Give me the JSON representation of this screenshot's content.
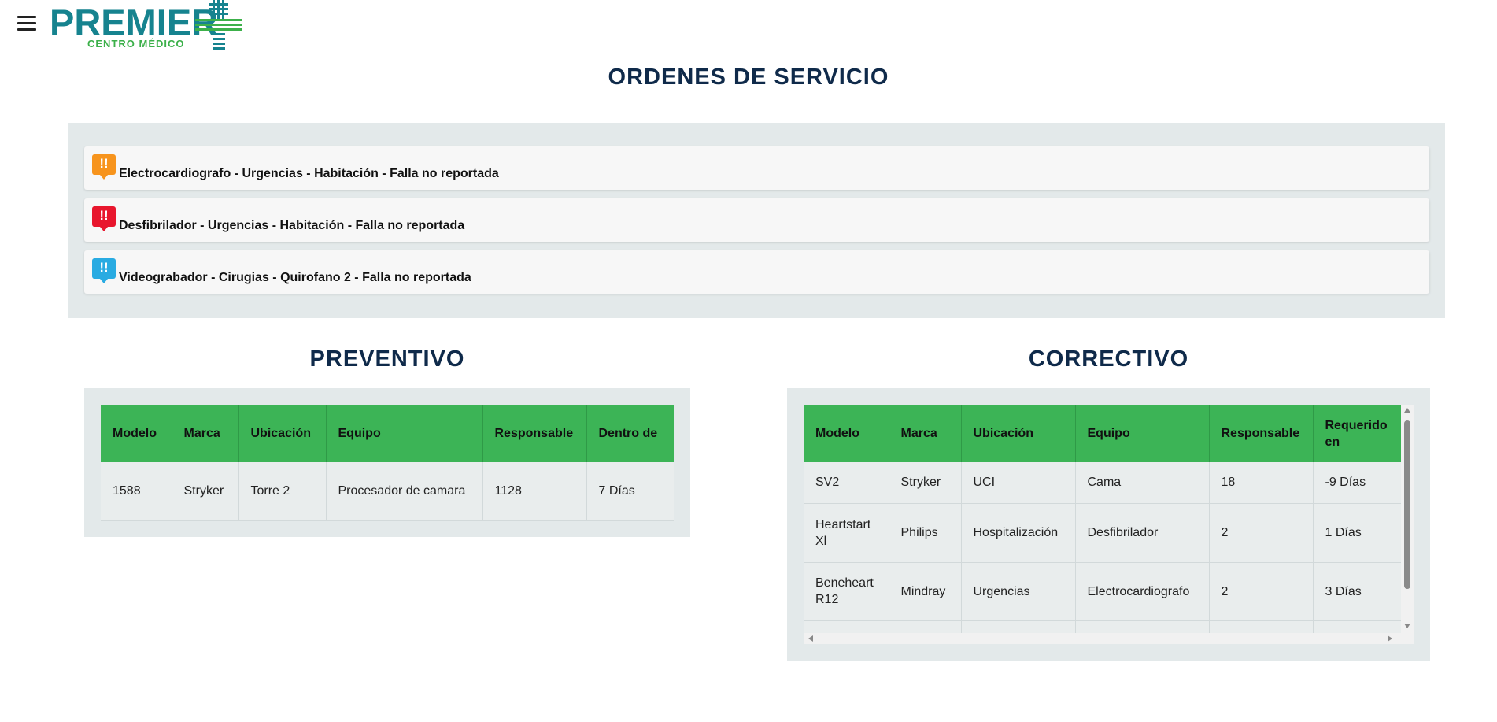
{
  "header": {
    "logo_text": "PREMIER",
    "logo_subtext": "CENTRO MÉDICO"
  },
  "page_title": "ORDENES DE SERVICIO",
  "alerts": [
    {
      "icon": "!!",
      "color": "#f7941d",
      "text": "Electrocardiografo - Urgencias - Habitación - Falla no reportada"
    },
    {
      "icon": "!!",
      "color": "#e8162d",
      "text": "Desfibrilador - Urgencias - Habitación - Falla no reportada"
    },
    {
      "icon": "!!",
      "color": "#29abe2",
      "text": "Videograbador - Cirugias - Quirofano 2 - Falla no reportada"
    }
  ],
  "preventivo": {
    "title": "PREVENTIVO",
    "headers": [
      "Modelo",
      "Marca",
      "Ubicación",
      "Equipo",
      "Responsable",
      "Dentro de"
    ],
    "rows": [
      [
        "1588",
        "Stryker",
        "Torre 2",
        "Procesador de camara",
        "1128",
        "7 Días"
      ]
    ]
  },
  "correctivo": {
    "title": "CORRECTIVO",
    "headers": [
      "Modelo",
      "Marca",
      "Ubicación",
      "Equipo",
      "Responsable",
      "Requerido en"
    ],
    "rows": [
      [
        "SV2",
        "Stryker",
        "UCI",
        "Cama",
        "18",
        "-9 Días"
      ],
      [
        "Heartstart Xl",
        "Philips",
        "Hospitalización",
        "Desfibrilador",
        "2",
        "1 Días"
      ],
      [
        "Beneheart R12",
        "Mindray",
        "Urgencias",
        "Electrocardiografo",
        "2",
        "3 Días"
      ]
    ]
  },
  "colors": {
    "title": "#0f2a4a",
    "table_header": "#3cb456",
    "panel_bg": "#e3e9ea",
    "logo_teal": "#16838f",
    "logo_green": "#3cb04a"
  }
}
